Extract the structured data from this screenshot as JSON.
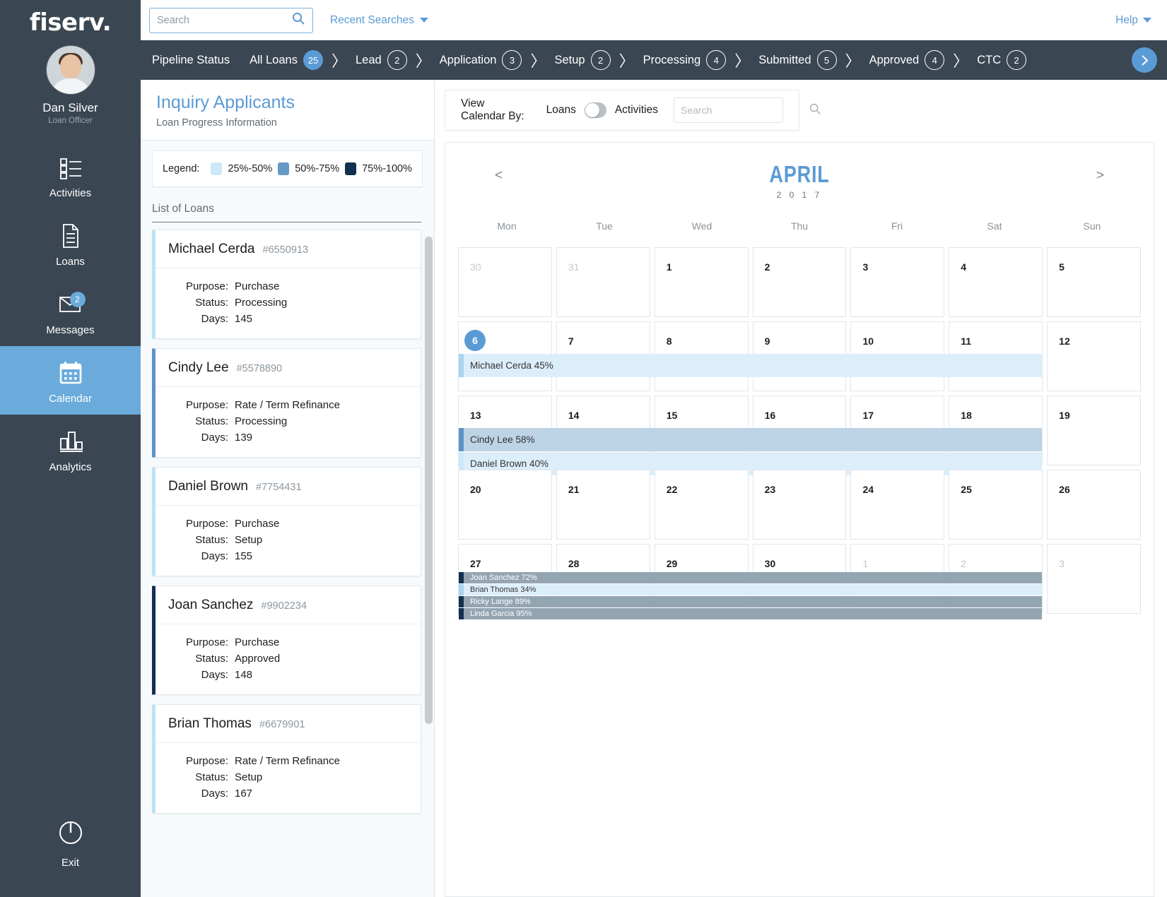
{
  "colors": {
    "rail_bg": "#3a4652",
    "accent": "#5b9bd5",
    "range_25_50": "#cde8f9",
    "range_50_75": "#6699c6",
    "range_75_100": "#12304f",
    "evt_low_bg": "#ddeefb",
    "evt_mid_bg": "#bdd3e6",
    "evt_high_bg": "#94a5b2"
  },
  "brand": {
    "name": "fiserv."
  },
  "user": {
    "name": "Dan Silver",
    "role": "Loan Officer",
    "avatar_icon": "user-avatar"
  },
  "nav": {
    "items": [
      {
        "label": "Activities",
        "icon": "checklist-icon",
        "active": false,
        "badge": ""
      },
      {
        "label": "Loans",
        "icon": "document-icon",
        "active": false,
        "badge": ""
      },
      {
        "label": "Messages",
        "icon": "envelope-icon",
        "active": false,
        "badge": "2"
      },
      {
        "label": "Calendar",
        "icon": "calendar-icon",
        "active": true,
        "badge": ""
      },
      {
        "label": "Analytics",
        "icon": "bar-chart-icon",
        "active": false,
        "badge": ""
      }
    ],
    "exit": {
      "label": "Exit",
      "icon": "power-icon"
    }
  },
  "topbar": {
    "search_placeholder": "Search",
    "search_value": "",
    "search_icon": "search-icon",
    "recent_searches": "Recent Searches",
    "help": "Help"
  },
  "pipeline": {
    "label": "Pipeline Status",
    "stages": [
      {
        "name": "All Loans",
        "count": "25",
        "selected": true
      },
      {
        "name": "Lead",
        "count": "2",
        "selected": false
      },
      {
        "name": "Application",
        "count": "3",
        "selected": false
      },
      {
        "name": "Setup",
        "count": "2",
        "selected": false
      },
      {
        "name": "Processing",
        "count": "4",
        "selected": false
      },
      {
        "name": "Submitted",
        "count": "5",
        "selected": false
      },
      {
        "name": "Approved",
        "count": "4",
        "selected": false
      },
      {
        "name": "CTC",
        "count": "2",
        "selected": false
      }
    ],
    "next_icon": "chevron-right-icon"
  },
  "inquiry": {
    "title": "Inquiry Applicants",
    "subtitle": "Loan Progress Information",
    "legend_label": "Legend:",
    "legend": [
      {
        "range": "25%-50%",
        "color": "#cde8f9"
      },
      {
        "range": "50%-75%",
        "color": "#6699c6"
      },
      {
        "range": "75%-100%",
        "color": "#12304f"
      }
    ],
    "list_header": "List of Loans",
    "field_labels": {
      "purpose": "Purpose:",
      "status": "Status:",
      "days": "Days:"
    },
    "loans": [
      {
        "name": "Michael Cerda",
        "number": "#6550913",
        "purpose": "Purchase",
        "status": "Processing",
        "days": "145",
        "bar_color": "#bfe2f7"
      },
      {
        "name": "Cindy Lee",
        "number": "#5578890",
        "purpose": "Rate / Term Refinance",
        "status": "Processing",
        "days": "139",
        "bar_color": "#5b94c4"
      },
      {
        "name": "Daniel Brown",
        "number": "#7754431",
        "purpose": "Purchase",
        "status": "Setup",
        "days": "155",
        "bar_color": "#bfe2f7"
      },
      {
        "name": "Joan Sanchez",
        "number": "#9902234",
        "purpose": "Purchase",
        "status": "Approved",
        "days": "148",
        "bar_color": "#12304f"
      },
      {
        "name": "Brian Thomas",
        "number": "#6679901",
        "purpose": "Rate / Term Refinance",
        "status": "Setup",
        "days": "167",
        "bar_color": "#bfe2f7"
      }
    ]
  },
  "calendar_controls": {
    "view_by_label": "View Calendar By:",
    "option_left": "Loans",
    "option_right": "Activities",
    "toggle_state": "Loans",
    "search_placeholder": "Search",
    "search_value": "",
    "search_icon": "search-icon"
  },
  "calendar": {
    "month": "APRIL",
    "year": "2 0 1 7",
    "prev_icon": "chevron-left-icon",
    "next_icon": "chevron-right-icon",
    "prev_label": "<",
    "next_label": ">",
    "day_names": [
      "Mon",
      "Tue",
      "Wed",
      "Thu",
      "Fri",
      "Sat",
      "Sun"
    ],
    "today": 6,
    "weeks": [
      {
        "days": [
          {
            "n": "30",
            "muted": true
          },
          {
            "n": "31",
            "muted": true
          },
          {
            "n": "1"
          },
          {
            "n": "2"
          },
          {
            "n": "3"
          },
          {
            "n": "4"
          },
          {
            "n": "5"
          }
        ],
        "events": []
      },
      {
        "days": [
          {
            "n": "6",
            "today": true
          },
          {
            "n": "7"
          },
          {
            "n": "8"
          },
          {
            "n": "9"
          },
          {
            "n": "10"
          },
          {
            "n": "11"
          },
          {
            "n": "12"
          }
        ],
        "events": [
          {
            "label": "Michael Cerda 45%",
            "span": 6,
            "bg": "#ddeefb",
            "bar": "#aad4f0",
            "text": "#333333",
            "compact": false
          }
        ]
      },
      {
        "days": [
          {
            "n": "13"
          },
          {
            "n": "14"
          },
          {
            "n": "15"
          },
          {
            "n": "16"
          },
          {
            "n": "17"
          },
          {
            "n": "18"
          },
          {
            "n": "19"
          }
        ],
        "events": [
          {
            "label": "Cindy Lee 58%",
            "span": 6,
            "bg": "#bdd3e6",
            "bar": "#5b94c4",
            "text": "#333333",
            "compact": false
          },
          {
            "label": "Daniel Brown 40%",
            "span": 6,
            "bg": "#ddeefb",
            "bar": "#cde8f9",
            "text": "#333333",
            "compact": false
          }
        ]
      },
      {
        "days": [
          {
            "n": "20"
          },
          {
            "n": "21"
          },
          {
            "n": "22"
          },
          {
            "n": "23"
          },
          {
            "n": "24"
          },
          {
            "n": "25"
          },
          {
            "n": "26"
          }
        ],
        "events": []
      },
      {
        "days": [
          {
            "n": "27"
          },
          {
            "n": "28"
          },
          {
            "n": "29"
          },
          {
            "n": "30"
          },
          {
            "n": "1",
            "muted": true
          },
          {
            "n": "2",
            "muted": true
          },
          {
            "n": "3",
            "muted": true
          }
        ],
        "events": [
          {
            "label": "Joan Sanchez 72%",
            "span": 6,
            "bg": "#94a5b2",
            "bar": "#12304f",
            "text": "#ffffff",
            "compact": true
          },
          {
            "label": "Brian Thomas 34%",
            "span": 6,
            "bg": "#ddeefb",
            "bar": "#aad4f0",
            "text": "#333333",
            "compact": true
          },
          {
            "label": "Ricky Lange 89%",
            "span": 6,
            "bg": "#94a5b2",
            "bar": "#12304f",
            "text": "#ffffff",
            "compact": true
          },
          {
            "label": "Linda Garcia 95%",
            "span": 6,
            "bg": "#94a5b2",
            "bar": "#12304f",
            "text": "#ffffff",
            "compact": true
          }
        ]
      }
    ]
  }
}
